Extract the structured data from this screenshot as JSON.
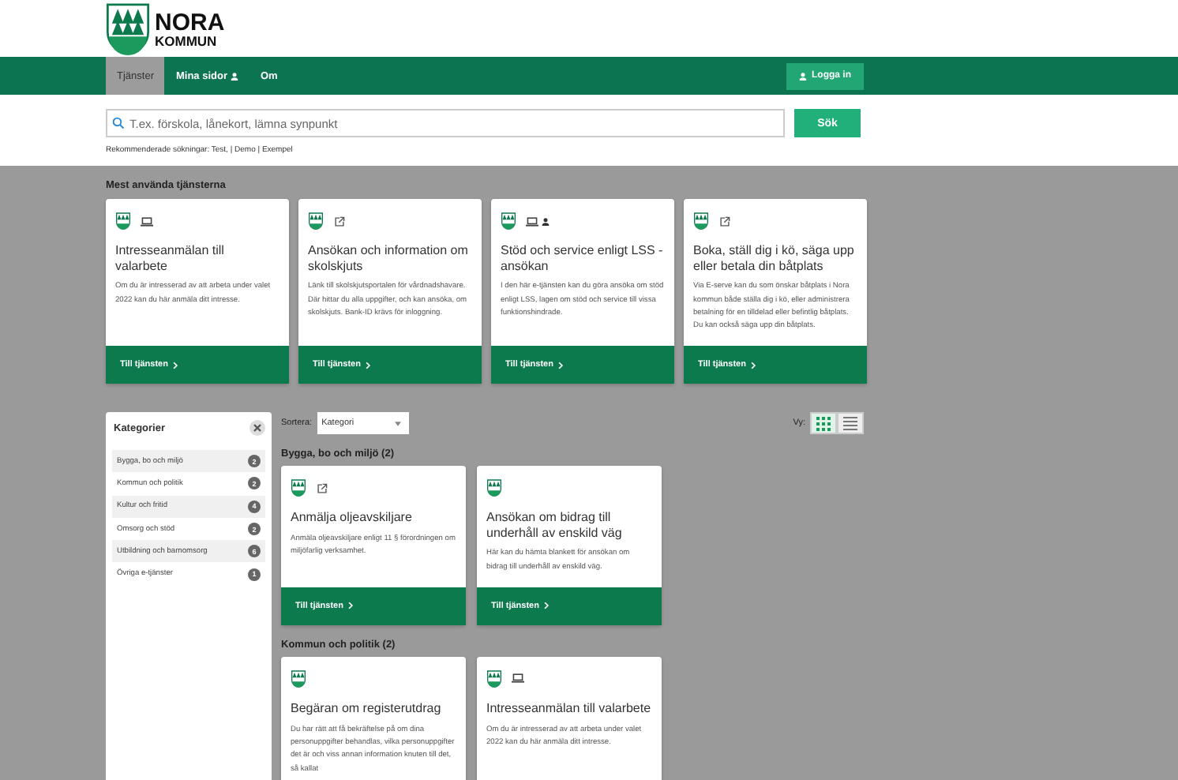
{
  "logo": {
    "line1": "NORA",
    "line2": "KOMMUN"
  },
  "nav": {
    "tabs": [
      {
        "label": "Tjänster",
        "selected": true,
        "user_icon": false
      },
      {
        "label": "Mina sidor",
        "selected": false,
        "user_icon": true
      },
      {
        "label": "Om",
        "selected": false,
        "user_icon": false
      }
    ],
    "login_button": "Logga in"
  },
  "search": {
    "placeholder": "T.ex. förskola, lånekort, lämna synpunkt",
    "button": "Sök",
    "recommended": "Rekommenderade sökningar: Test, | Demo | Exempel"
  },
  "popular": {
    "heading": "Mest använda tjänsterna",
    "cards": [
      {
        "icons": [
          {
            "kind": "laptop"
          }
        ],
        "title": "Intresseanmälan till valarbete",
        "description": "Om du är intresserad av att arbeta under valet 2022 kan du här anmäla ditt intresse.",
        "link": "Till tjänsten"
      },
      {
        "icons": [
          {
            "kind": "external"
          }
        ],
        "title": "Ansökan och information om skolskjuts",
        "description": "Länk till skolskjutsportalen för vårdnadshavare. Där hittar du alla uppgifter, och kan ansöka, om skolskjuts. Bank-ID krävs för inloggning.",
        "link": "Till tjänsten"
      },
      {
        "icons": [
          {
            "kind": "laptop"
          },
          {
            "kind": "person"
          }
        ],
        "title": "Stöd och service enligt LSS - ansökan",
        "description": "I den här e-tjänsten kan du göra ansöka om stöd enligt LSS, lagen om stöd och service till vissa funktionshindrade.",
        "link": "Till tjänsten"
      },
      {
        "icons": [
          {
            "kind": "external"
          }
        ],
        "title": "Boka, ställ dig i kö, säga upp eller betala din båtplats",
        "description": "Via E-serve kan du som önskar båtplats i Nora kommun både ställa dig i kö, eller administrera betalning för en tilldelad eller befintlig båtplats. Du kan också säga upp din båtplats.",
        "link": "Till tjänsten"
      }
    ]
  },
  "categories": {
    "title": "Kategorier",
    "items": [
      {
        "label": "Bygga, bo och miljö",
        "count": "2"
      },
      {
        "label": "Kommun och politik",
        "count": "2"
      },
      {
        "label": "Kultur och fritid",
        "count": "4"
      },
      {
        "label": "Omsorg och stöd",
        "count": "2"
      },
      {
        "label": "Utbildning och barnomsorg",
        "count": "6"
      },
      {
        "label": "Övriga e-tjänster",
        "count": "1"
      }
    ]
  },
  "sort": {
    "label": "Sortera:",
    "value": "Kategori"
  },
  "view": {
    "label": "Vy:",
    "options": [
      {
        "kind": "grid",
        "selected": true
      },
      {
        "kind": "list",
        "selected": false
      }
    ]
  },
  "groups": [
    {
      "heading": "Bygga, bo och miljö (2)",
      "cards": [
        {
          "icons": [
            {
              "kind": "external"
            }
          ],
          "title": "Anmälja oljeavskiljare",
          "description": "Anmäla oljeavskiljare enligt 11 § förordningen om miljöfarlig verksamhet.",
          "link": "Till tjänsten"
        },
        {
          "title": "Ansökan om bidrag till underhåll av enskild väg",
          "description": "Här kan du hämta blankett för ansökan om bidrag till underhåll av enskild väg.",
          "link": "Till tjänsten"
        }
      ]
    },
    {
      "heading": "Kommun och politik (2)",
      "cards": [
        {
          "title": "Begäran om registerutdrag",
          "description": "Du har rätt att få bekräftelse på om dina personuppgifter behandlas, vilka personuppgifter det är och viss annan information knuten till det, så kallat"
        },
        {
          "icons": [
            {
              "kind": "laptop"
            }
          ],
          "title": "Intresseanmälan till valarbete",
          "description": "Om du är intresserad av att arbeta under valet 2022 kan du här anmäla ditt intresse."
        }
      ]
    }
  ]
}
